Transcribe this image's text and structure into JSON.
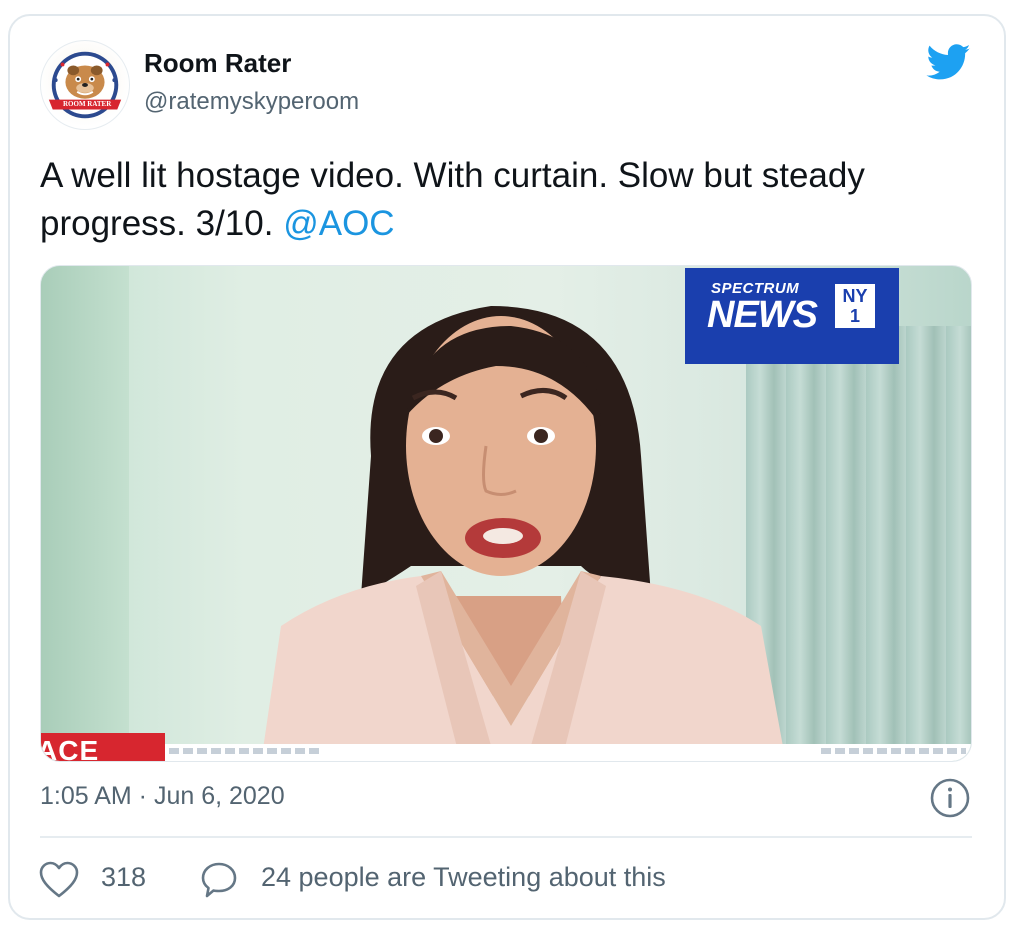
{
  "author": {
    "name": "Room Rater",
    "handle": "@ratemyskyperoom",
    "avatar_text": "ROOM RATER"
  },
  "tweet": {
    "text": "A well lit hostage video. With curtain. Slow but steady progress. 3/10. ",
    "mention": "@AOC"
  },
  "media": {
    "broadcaster_top": "SPECTRUM",
    "broadcaster_main": "NEWS",
    "broadcaster_badge_top": "NY",
    "broadcaster_badge_bottom": "1",
    "lower_third_text": "ACE"
  },
  "meta": {
    "timestamp": "1:05 AM · Jun 6, 2020"
  },
  "actions": {
    "like_count": "318",
    "tweeting_label": "24 people are Tweeting about this"
  },
  "icons": {
    "brand": "twitter-bird-icon",
    "info": "info-icon",
    "like": "heart-icon",
    "reply": "speech-bubble-icon"
  },
  "colors": {
    "link": "#1b95e0",
    "twitter_blue": "#1da1f2",
    "news_blue": "#1a3fae",
    "race_red": "#d7262f",
    "secondary_text": "#536471"
  }
}
